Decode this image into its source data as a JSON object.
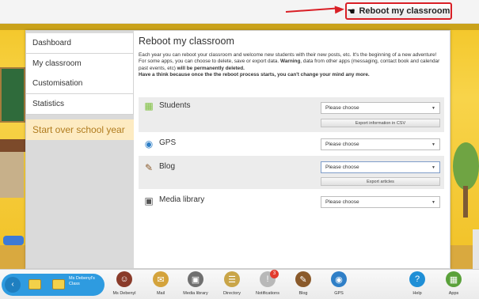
{
  "header": {
    "reboot_button_label": "Reboot my classroom"
  },
  "sidebar": {
    "items": [
      {
        "label": "Dashboard"
      },
      {
        "label": "My classroom"
      },
      {
        "label": "Customisation"
      },
      {
        "label": "Statistics"
      }
    ],
    "active_item": "Start over school year"
  },
  "main": {
    "title": "Reboot my classroom",
    "description": {
      "intro": "Each year you can reboot your classroom and welcome new students with their new posts, etc. It's the beginning of a new adventure!",
      "line2_a": "For some apps, you can choose to delete, save or export data. ",
      "warning": "Warning",
      "line2_b": ", data from other apps (messaging, contact book and calendar past events, etc) ",
      "line2_c": "will be permanently deleted.",
      "line3": "Have a think because once the the reboot process starts, you can't change your mind any more."
    },
    "sections": [
      {
        "name": "Students",
        "icon": "students-icon",
        "select": "Please choose",
        "action": "Export information in CSV"
      },
      {
        "name": "GPS",
        "icon": "globe-icon",
        "select": "Please choose"
      },
      {
        "name": "Blog",
        "icon": "blog-icon",
        "select": "Please choose",
        "action": "Export articles"
      },
      {
        "name": "Media library",
        "icon": "media-library-icon",
        "select": "Please choose"
      }
    ]
  },
  "dock": {
    "class_name": "Ms Debenyl's Class",
    "apps": [
      {
        "label": "Ms Debenyl",
        "icon": "avatar-icon"
      },
      {
        "label": "Mail",
        "icon": "mail-icon"
      },
      {
        "label": "Media library",
        "icon": "media-library-icon"
      },
      {
        "label": "Directory",
        "icon": "directory-icon"
      },
      {
        "label": "Notifications",
        "icon": "notifications-icon",
        "badge": "3"
      },
      {
        "label": "Blog",
        "icon": "blog-icon"
      },
      {
        "label": "GPS",
        "icon": "globe-icon"
      },
      {
        "label": "Help",
        "icon": "help-icon"
      },
      {
        "label": "Apps",
        "icon": "apps-grid-icon"
      }
    ]
  },
  "colors": {
    "highlight": "#d91f26",
    "active_nav_bg": "#fdebc2",
    "active_nav_text": "#b07b1e",
    "dock_accent": "#2e9be0"
  }
}
